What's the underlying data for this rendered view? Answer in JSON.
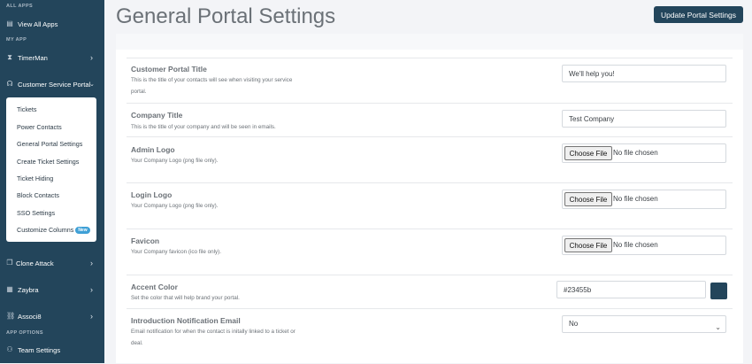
{
  "sidebar": {
    "section_all_apps": "ALL APPS",
    "view_all_apps": "View All Apps",
    "section_my_app": "MY APP",
    "timerman": "TimerMan",
    "customer_service_portal": "Customer Service Portal",
    "submenu": {
      "tickets": "Tickets",
      "power_contacts": "Power Contacts",
      "general_portal_settings": "General Portal Settings",
      "create_ticket_settings": "Create Ticket Settings",
      "ticket_hiding": "Ticket Hiding",
      "block_contacts": "Block Contacts",
      "sso_settings": "SSO Settings",
      "customize_columns": "Customize Columns",
      "new_badge": "New"
    },
    "clone_attack": "Clone Attack",
    "zaybra": "Zaybra",
    "associ8": "Associ8",
    "section_app_options": "APP OPTIONS",
    "team_settings": "Team Settings",
    "icons": {
      "view_all_apps": "grid-icon",
      "timerman": "hourglass-icon",
      "csp": "headset-icon",
      "clone_attack": "copy-icon",
      "zaybra": "keyboard-icon",
      "associ8": "connection-icon",
      "team_settings": "team-icon"
    }
  },
  "header": {
    "title": "General Portal Settings",
    "update_button": "Update Portal Settings"
  },
  "form": {
    "customer_portal_title": {
      "label": "Customer Portal Title",
      "description": "This is the title of your contacts will see when visiting your service portal.",
      "value": "We'll help you!"
    },
    "company_title": {
      "label": "Company Title",
      "description": "This is the title of your company and will be seen in emails.",
      "value": "Test Company"
    },
    "admin_logo": {
      "label": "Admin Logo",
      "description": "Your Company Logo (png file only).",
      "button": "Choose File",
      "status": "No file chosen"
    },
    "login_logo": {
      "label": "Login Logo",
      "description": "Your Company Logo (png file only).",
      "button": "Choose File",
      "status": "No file chosen"
    },
    "favicon": {
      "label": "Favicon",
      "description": "Your Company favicon (ico file only).",
      "button": "Choose File",
      "status": "No file chosen"
    },
    "accent_color": {
      "label": "Accent Color",
      "description": "Set the color that will help brand your portal.",
      "value": "#23455b"
    },
    "intro_email": {
      "label": "Introduction Notification Email",
      "description": "Email notification for when the contact is initally linked to a ticket or deal.",
      "value": "No"
    }
  },
  "colors": {
    "sidebar_bg": "#23455b",
    "accent": "#23455b",
    "badge": "#3fa0d6"
  }
}
